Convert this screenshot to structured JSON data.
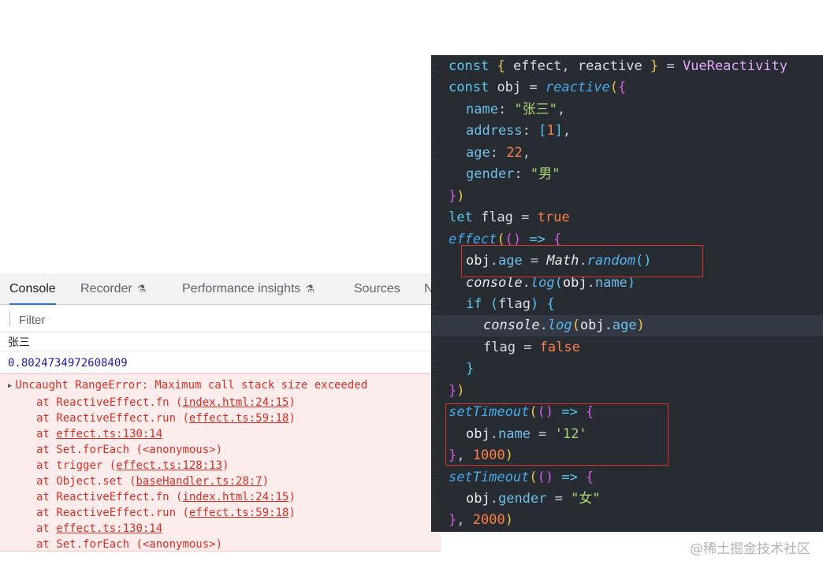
{
  "devtools": {
    "tabs": [
      {
        "label": "Console",
        "active": true
      },
      {
        "label": "Recorder",
        "icon": "flask-icon"
      },
      {
        "label": "Performance insights",
        "icon": "flask-icon"
      },
      {
        "label": "Sources"
      },
      {
        "label": "N"
      }
    ],
    "filter_placeholder": "Filter",
    "messages": [
      "张三",
      "0.8024734972608409"
    ],
    "error": {
      "headline": "Uncaught RangeError: Maximum call stack size exceeded",
      "stack": [
        {
          "fn": "ReactiveEffect.fn",
          "loc": "index.html:24:15"
        },
        {
          "fn": "ReactiveEffect.run",
          "loc": "effect.ts:59:18"
        },
        {
          "fn": "",
          "loc": "effect.ts:130:14"
        },
        {
          "fn": "Set.forEach",
          "loc": "<anonymous>",
          "plain": true
        },
        {
          "fn": "trigger",
          "loc": "effect.ts:128:13"
        },
        {
          "fn": "Object.set",
          "loc": "baseHandler.ts:28:7"
        },
        {
          "fn": "ReactiveEffect.fn",
          "loc": "index.html:24:15"
        },
        {
          "fn": "ReactiveEffect.run",
          "loc": "effect.ts:59:18"
        },
        {
          "fn": "",
          "loc": "effect.ts:130:14"
        },
        {
          "fn": "Set.forEach",
          "loc": "<anonymous>",
          "plain": true
        }
      ]
    }
  },
  "code": {
    "t": {
      "const": "const",
      "let": "let",
      "if": "if",
      "effect": "effect",
      "reactive": "reactive",
      "VueReactivity": "VueReactivity",
      "obj": "obj",
      "flag": "flag",
      "true": "true",
      "false": "false",
      "name": "name",
      "address": "address",
      "age": "age",
      "gender": "gender",
      "zhangsan": "\"张三\"",
      "male": "\"男\"",
      "female": "\"女\"",
      "s12": "'12'",
      "n1": "1",
      "n22": "22",
      "n1000": "1000",
      "n2000": "2000",
      "Math": "Math",
      "random": "random",
      "console": "console",
      "log": "log",
      "setTimeout": "setTimeout"
    }
  },
  "watermark": "@稀土掘金技术社区"
}
